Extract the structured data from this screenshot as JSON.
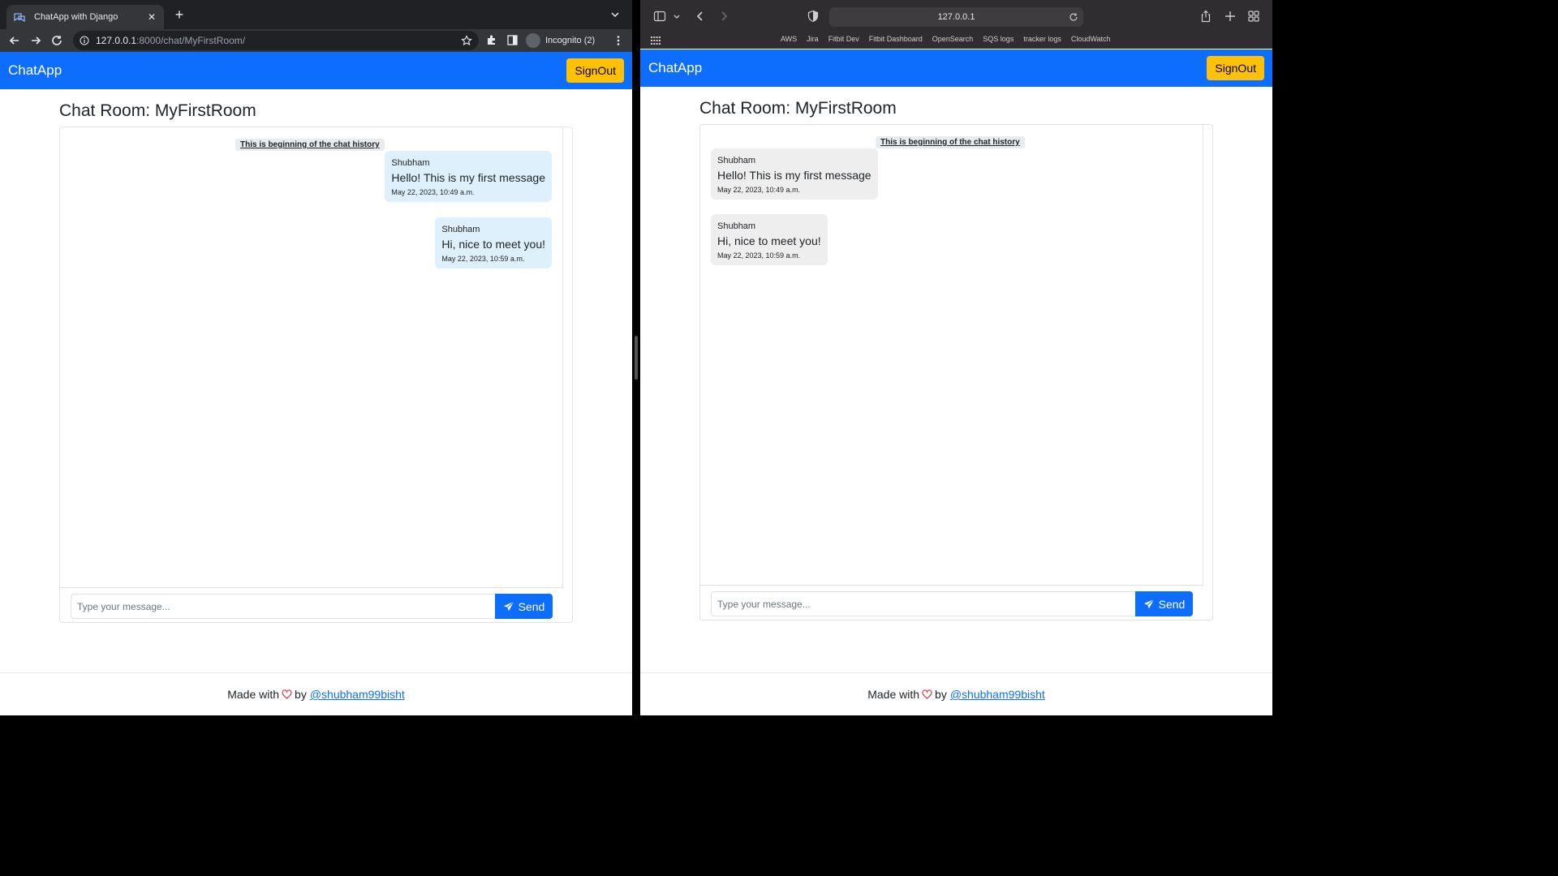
{
  "chrome": {
    "tab_title": "ChatApp with Django",
    "url_host": "127.0.0.1",
    "url_rest": ":8000/chat/MyFirstRoom/",
    "incognito_label": "Incognito (2)"
  },
  "safari": {
    "address": "127.0.0.1",
    "bookmarks": [
      "AWS",
      "Jira",
      "Fitbit Dev",
      "Fitbit Dashboard",
      "OpenSearch",
      "SQS logs",
      "tracker logs",
      "CloudWatch"
    ]
  },
  "app": {
    "brand": "ChatApp",
    "signout_label": "SignOut",
    "room_title": "Chat Room: MyFirstRoom",
    "history_note": "This is beginning of the chat history",
    "messages": [
      {
        "user": "Shubham",
        "text": "Hello! This is my first message",
        "time": "May 22, 2023, 10:49 a.m."
      },
      {
        "user": "Shubham",
        "text": "Hi, nice to meet you!",
        "time": "May 22, 2023, 10:59 a.m."
      }
    ],
    "input_placeholder": "Type your message...",
    "send_label": "Send",
    "footer": {
      "made_with": "Made with",
      "by": "by",
      "link": "@shubham99bisht"
    }
  },
  "colors": {
    "navbar": "#0d6efd",
    "signout": "#ffc107",
    "own_bubble": "#def0fc",
    "other_bubble": "#eeeeee",
    "heart": "#dc3545"
  }
}
